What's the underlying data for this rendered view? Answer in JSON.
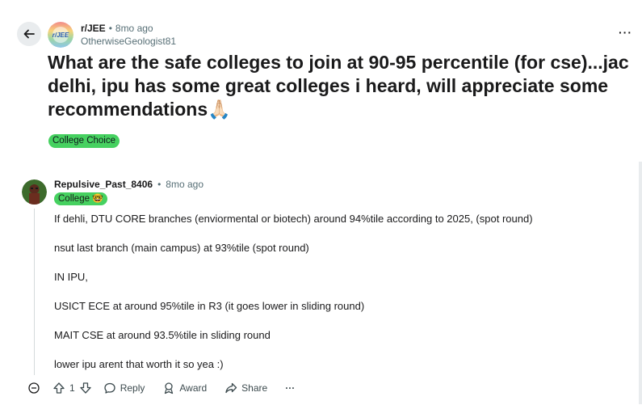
{
  "post": {
    "subreddit": "r/JEE",
    "time": "8mo ago",
    "author": "OtherwiseGeologist81",
    "title": "What are the safe colleges to join at 90-95 percentile (for cse)...jac delhi, ipu has some great colleges i heard, will appreciate some recommendations",
    "title_emoji": "🙏🏻",
    "flair": "College Choice",
    "subreddit_icon_text": "r/JEE"
  },
  "comment": {
    "username": "Repulsive_Past_8406",
    "time": "8mo ago",
    "flair": "College",
    "flair_emoji": "🤓",
    "paragraphs": [
      "If dehli, DTU CORE branches (enviormental or biotech) around 94%tile according to 2025, (spot round)",
      "nsut last branch (main campus) at 93%tile (spot round)",
      "IN IPU,",
      "USICT ECE at around 95%tile in R3 (it goes lower in sliding round)",
      "MAIT CSE at around 93.5%tile in sliding round",
      "lower ipu arent that worth it so yea :)"
    ],
    "actions": {
      "vote_count": "1",
      "reply_label": "Reply",
      "award_label": "Award",
      "share_label": "Share",
      "more_label": "···"
    }
  },
  "header": {
    "more_label": "···"
  },
  "colors": {
    "flair_green": "#46d160",
    "meta_gray": "#576f76",
    "back_button_bg": "#e9ecee"
  },
  "icons": [
    "back-arrow-icon",
    "subreddit-icon",
    "more-icon",
    "collapse-icon",
    "upvote-icon",
    "downvote-icon",
    "reply-icon",
    "award-icon",
    "share-icon",
    "user-avatar"
  ]
}
